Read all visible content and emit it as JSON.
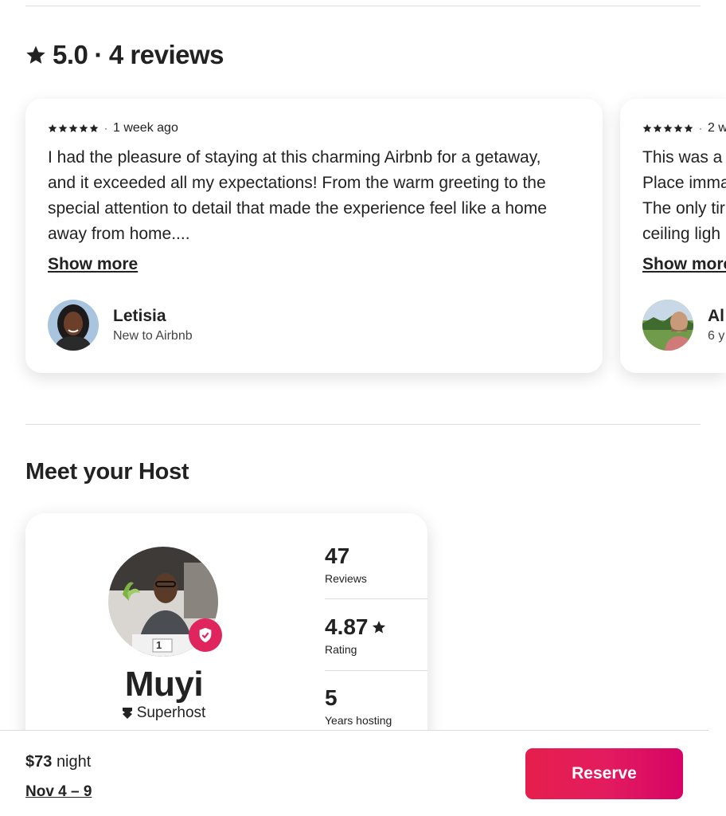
{
  "reviews_section": {
    "rating": "5.0",
    "separator": "·",
    "count_label": "4 reviews",
    "cards": [
      {
        "time": "1 week ago",
        "lines": [
          "I had the pleasure of staying at this charming Airbnb for a getaway,",
          "and it exceeded all my expectations! From the warm greeting to the",
          "special attention to detail that made the experience feel like a home",
          "away from home...."
        ],
        "show_more": "Show more",
        "reviewer_name": "Letisia",
        "reviewer_sub": "New to Airbnb"
      },
      {
        "time": "2 w",
        "lines": [
          "This was a v",
          "Place imma",
          "The only tir",
          "ceiling ligh"
        ],
        "show_more": "Show more",
        "reviewer_name": "Al",
        "reviewer_sub": "6 y"
      }
    ]
  },
  "host_section": {
    "title": "Meet your Host",
    "name": "Muyi",
    "badge": "Superhost",
    "photo_tag": "1",
    "stats": [
      {
        "value": "47",
        "label": "Reviews"
      },
      {
        "value": "4.87",
        "label": "Rating"
      },
      {
        "value": "5",
        "label": "Years hosting"
      }
    ]
  },
  "footer": {
    "price": "$73",
    "unit": "night",
    "dates": "Nov 4 – 9",
    "reserve_label": "Reserve"
  },
  "colors": {
    "brand": "#e31c5f",
    "text": "#222222",
    "divider": "#dddddd"
  },
  "icons": [
    "star-icon",
    "verified-shield-icon",
    "superhost-medal-icon"
  ]
}
